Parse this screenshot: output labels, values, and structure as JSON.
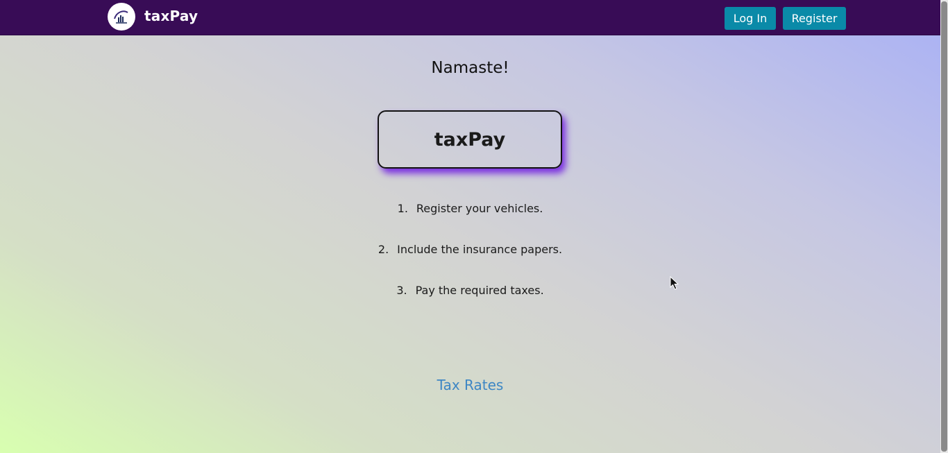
{
  "navbar": {
    "brand_name": "taxPay",
    "login_label": "Log In",
    "register_label": "Register",
    "background_color": "#380c56",
    "button_color": "#0a8aa8"
  },
  "main": {
    "greeting": "Namaste!",
    "hero_title": "taxPay",
    "steps": [
      {
        "number": "1.",
        "text": "Register your vehicles."
      },
      {
        "number": "2.",
        "text": "Include the insurance papers."
      },
      {
        "number": "3.",
        "text": "Pay the required taxes."
      }
    ],
    "tax_rates_link": "Tax Rates"
  },
  "colors": {
    "accent_shadow": "#7a2fe0",
    "link": "#3d86c4"
  },
  "icons": {
    "logo": "tax-chart-logo-icon",
    "cursor": "mouse-pointer-icon"
  }
}
